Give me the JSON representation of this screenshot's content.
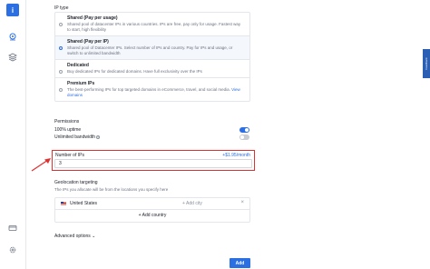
{
  "sidebar": {
    "info_label": "i"
  },
  "ip_type": {
    "label": "IP type",
    "options": [
      {
        "title": "Shared (Pay per usage)",
        "desc": "Shared pool of datacenter IPs in various countries. IPs are free, pay only for usage. Fastest way to start, high flexibility",
        "selected": false
      },
      {
        "title": "Shared (Pay per IP)",
        "desc": "Shared pool of Datacenter IPs. Select number of IPs and country. Pay for IPs and usage, or switch to unlimited bandwidth",
        "selected": true
      },
      {
        "title": "Dedicated",
        "desc": "Buy dedicated IPs for dedicated domains. Have full exclusivity over the IPs",
        "selected": false
      },
      {
        "title": "Premium IPs",
        "desc": "The best-performing IPs for top targeted domains in eCommerce, travel, and social media.",
        "link": "View domains",
        "selected": false
      }
    ]
  },
  "permissions": {
    "label": "Permissions",
    "uptime_label": "100% uptime",
    "uptime_on": true,
    "bandwidth_label": "Unlimited bandwidth",
    "bandwidth_on": false,
    "help_icon": "question-icon"
  },
  "num_ips": {
    "label": "Number of IPs",
    "price": "+$1.95/month",
    "value": "3"
  },
  "geo": {
    "label": "Geolocation targeting",
    "hint": "The IPs you allocate will be from the locations you specify here",
    "countries": [
      {
        "name": "United States",
        "city_placeholder": "+ Add city",
        "flag_icon": "us-flag-icon"
      }
    ],
    "add_country": "+ Add country"
  },
  "advanced": "Advanced options",
  "add_button": "Add",
  "feedback_tab": "Feedback",
  "colors": {
    "accent": "#2b6fe3",
    "highlight": "#e03131"
  }
}
